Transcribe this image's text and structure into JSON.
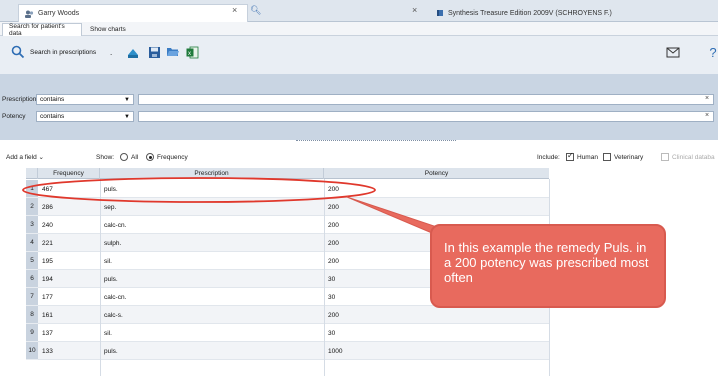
{
  "tabs": [
    {
      "label": "Garry Woods"
    },
    {
      "label": ""
    },
    {
      "label": "Synthesis Treasure Edition 2009V (SCHROYENS F.)"
    }
  ],
  "subtabs": [
    "Search for patient's data",
    "Show charts"
  ],
  "toolbar": {
    "search_label": "Search in prescriptions",
    "dropdown_caret": "."
  },
  "filters": [
    {
      "field": "Prescription",
      "operator": "contains",
      "value": ""
    },
    {
      "field": "Potency",
      "operator": "contains",
      "value": ""
    }
  ],
  "options": {
    "add_field_label": "Add a field",
    "show_label": "Show:",
    "show_all_label": "All",
    "show_frequency_label": "Frequency",
    "show_selected": "Frequency",
    "include_label": "Include:",
    "include_human_label": "Human",
    "include_human_checked": true,
    "include_veterinary_label": "Veterinary",
    "include_veterinary_checked": false,
    "include_clinical_label": "Clinical databa",
    "include_clinical_enabled": false
  },
  "table": {
    "columns": [
      "Frequency",
      "Prescription",
      "Potency"
    ],
    "rows": [
      {
        "n": "1",
        "frequency": "467",
        "prescription": "puls.",
        "potency": "200"
      },
      {
        "n": "2",
        "frequency": "286",
        "prescription": "sep.",
        "potency": "200"
      },
      {
        "n": "3",
        "frequency": "240",
        "prescription": "calc-cn.",
        "potency": "200"
      },
      {
        "n": "4",
        "frequency": "221",
        "prescription": "sulph.",
        "potency": "200"
      },
      {
        "n": "5",
        "frequency": "195",
        "prescription": "sil.",
        "potency": "200"
      },
      {
        "n": "6",
        "frequency": "194",
        "prescription": "puls.",
        "potency": "30"
      },
      {
        "n": "7",
        "frequency": "177",
        "prescription": "calc-cn.",
        "potency": "30"
      },
      {
        "n": "8",
        "frequency": "161",
        "prescription": "calc-s.",
        "potency": "200"
      },
      {
        "n": "9",
        "frequency": "137",
        "prescription": "sil.",
        "potency": "30"
      },
      {
        "n": "10",
        "frequency": "133",
        "prescription": "puls.",
        "potency": "1000"
      }
    ]
  },
  "annotation": {
    "text": "In this example the remedy Puls. in a 200 potency was prescribed most often",
    "color": "#e86a5e"
  }
}
